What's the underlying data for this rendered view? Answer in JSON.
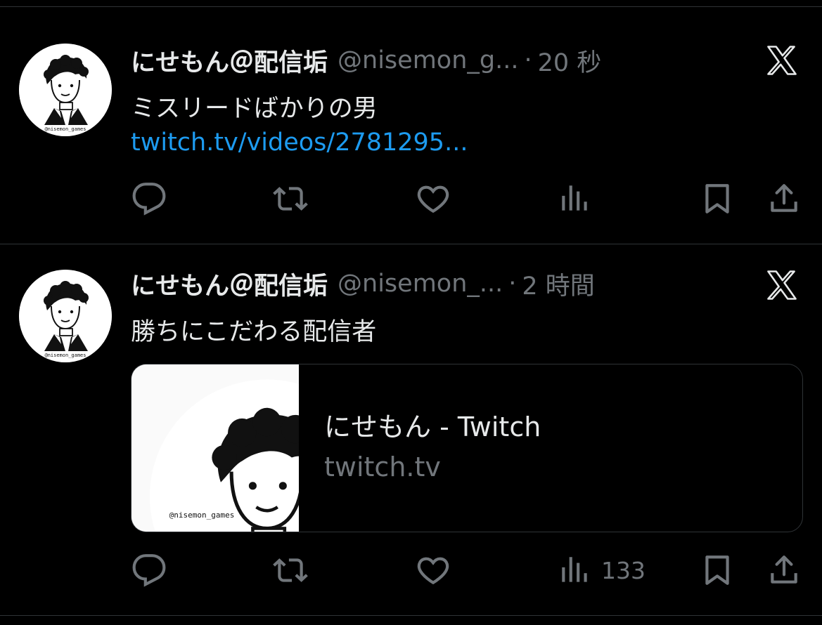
{
  "tweets": [
    {
      "display_name": "にせもん＠配信垢",
      "handle": "@nisemon_g...",
      "separator": "·",
      "time": "20 秒",
      "text": "ミスリードばかりの男",
      "link": "twitch.tv/videos/2781295...",
      "avatar_caption": "@nisemon_games",
      "views": ""
    },
    {
      "display_name": "にせもん＠配信垢",
      "handle": "@nisemon_...",
      "separator": "·",
      "time": "2 時間",
      "text": "勝ちにこだわる配信者",
      "avatar_caption": "@nisemon_games",
      "card": {
        "title": "にせもん - Twitch",
        "domain": "twitch.tv",
        "image_caption": "@nisemon_games"
      },
      "views": "133"
    }
  ],
  "icons": {
    "reply": "reply-icon",
    "retweet": "retweet-icon",
    "like": "heart-icon",
    "views": "views-icon",
    "bookmark": "bookmark-icon",
    "share": "share-icon",
    "source": "x-logo-icon"
  },
  "colors": {
    "background": "#000000",
    "text": "#e7e9ea",
    "muted": "#71767b",
    "link": "#1d9bf0",
    "divider": "#2f3336"
  }
}
